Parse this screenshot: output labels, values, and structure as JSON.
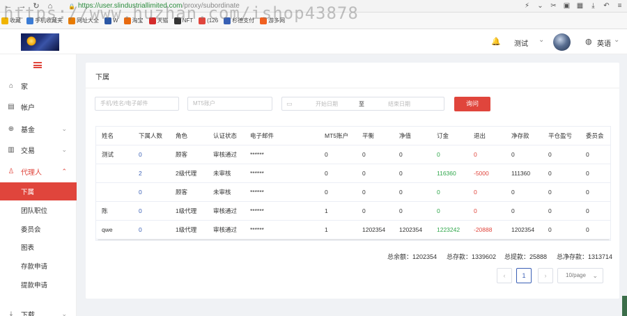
{
  "browser": {
    "url_host": "https://user.slindustriallimited.com",
    "url_path": "/proxy/subordinate",
    "bookmarks": [
      {
        "label": "收藏",
        "color": "#f0b400"
      },
      {
        "label": "手机收藏夹",
        "color": "#3a7bd5"
      },
      {
        "label": "网址大全",
        "color": "#e87b00"
      },
      {
        "label": "W",
        "color": "#2b57a5"
      },
      {
        "label": "淘宝",
        "color": "#e86a10"
      },
      {
        "label": "天猫",
        "color": "#d42b2b"
      },
      {
        "label": "NFT",
        "color": "#333333"
      },
      {
        "label": "(126",
        "color": "#e0453c"
      },
      {
        "label": "杉德支付",
        "color": "#3860b4"
      },
      {
        "label": "游多网",
        "color": "#f06020"
      }
    ],
    "watermark": "https://www.huzhan.com/ishop43878"
  },
  "header": {
    "user_name": "测试",
    "language": "英语"
  },
  "sidebar": {
    "items": [
      {
        "label": "家",
        "icon": "home-icon",
        "glyph": "⌂"
      },
      {
        "label": "帐户",
        "icon": "account-icon",
        "glyph": "▤"
      },
      {
        "label": "基金",
        "icon": "fund-icon",
        "glyph": "⊕",
        "chevron": "⌄"
      },
      {
        "label": "交易",
        "icon": "trade-icon",
        "glyph": "▥",
        "chevron": "⌄"
      },
      {
        "label": "代理人",
        "icon": "agent-icon",
        "glyph": "♙",
        "chevron": "⌃"
      }
    ],
    "sub_items": [
      "下属",
      "团队职位",
      "委员会",
      "图表",
      "存款申请",
      "提款申请"
    ],
    "bottom_item": {
      "label": "下载",
      "icon": "download-icon",
      "glyph": "⤓",
      "chevron": "⌄"
    }
  },
  "page": {
    "title": "下属",
    "filters": {
      "search_placeholder": "手机/姓名/电子邮件",
      "mt5_placeholder": "MT5账户",
      "start_date_placeholder": "开始日期",
      "range_separator": "至",
      "end_date_placeholder": "结束日期",
      "query_button": "询问"
    },
    "table": {
      "columns": [
        "姓名",
        "下属人数",
        "角色",
        "认证状态",
        "电子邮件",
        "MT5账户",
        "平衡",
        "净值",
        "订金",
        "退出",
        "净存款",
        "平仓盈亏",
        "委员会"
      ],
      "rows": [
        [
          "测试",
          "0",
          "顾客",
          "审核通过",
          "******",
          "0",
          "0",
          "0",
          "0",
          "0",
          "0",
          "0",
          "0"
        ],
        [
          "",
          "2",
          "2级代理",
          "未审核",
          "******",
          "0",
          "0",
          "0",
          "116360",
          "-5000",
          "111360",
          "0",
          "0"
        ],
        [
          "",
          "0",
          "顾客",
          "未审核",
          "******",
          "0",
          "0",
          "0",
          "0",
          "0",
          "0",
          "0",
          "0"
        ],
        [
          "陈",
          "0",
          "1级代理",
          "审核通过",
          "******",
          "1",
          "0",
          "0",
          "0",
          "0",
          "0",
          "0",
          "0"
        ],
        [
          "qwe",
          "0",
          "1级代理",
          "审核通过",
          "******",
          "1",
          "1202354",
          "1202354",
          "1223242",
          "-20888",
          "1202354",
          "0",
          "0"
        ]
      ]
    },
    "totals": {
      "balance": "总余额：1202354",
      "deposit": "总存款：1339602",
      "withdraw": "总提款：25888",
      "net_deposit": "总净存款：1313714"
    },
    "pagination": {
      "prev": "‹",
      "current_page": "1",
      "next": "›",
      "page_size": "10/page"
    }
  }
}
